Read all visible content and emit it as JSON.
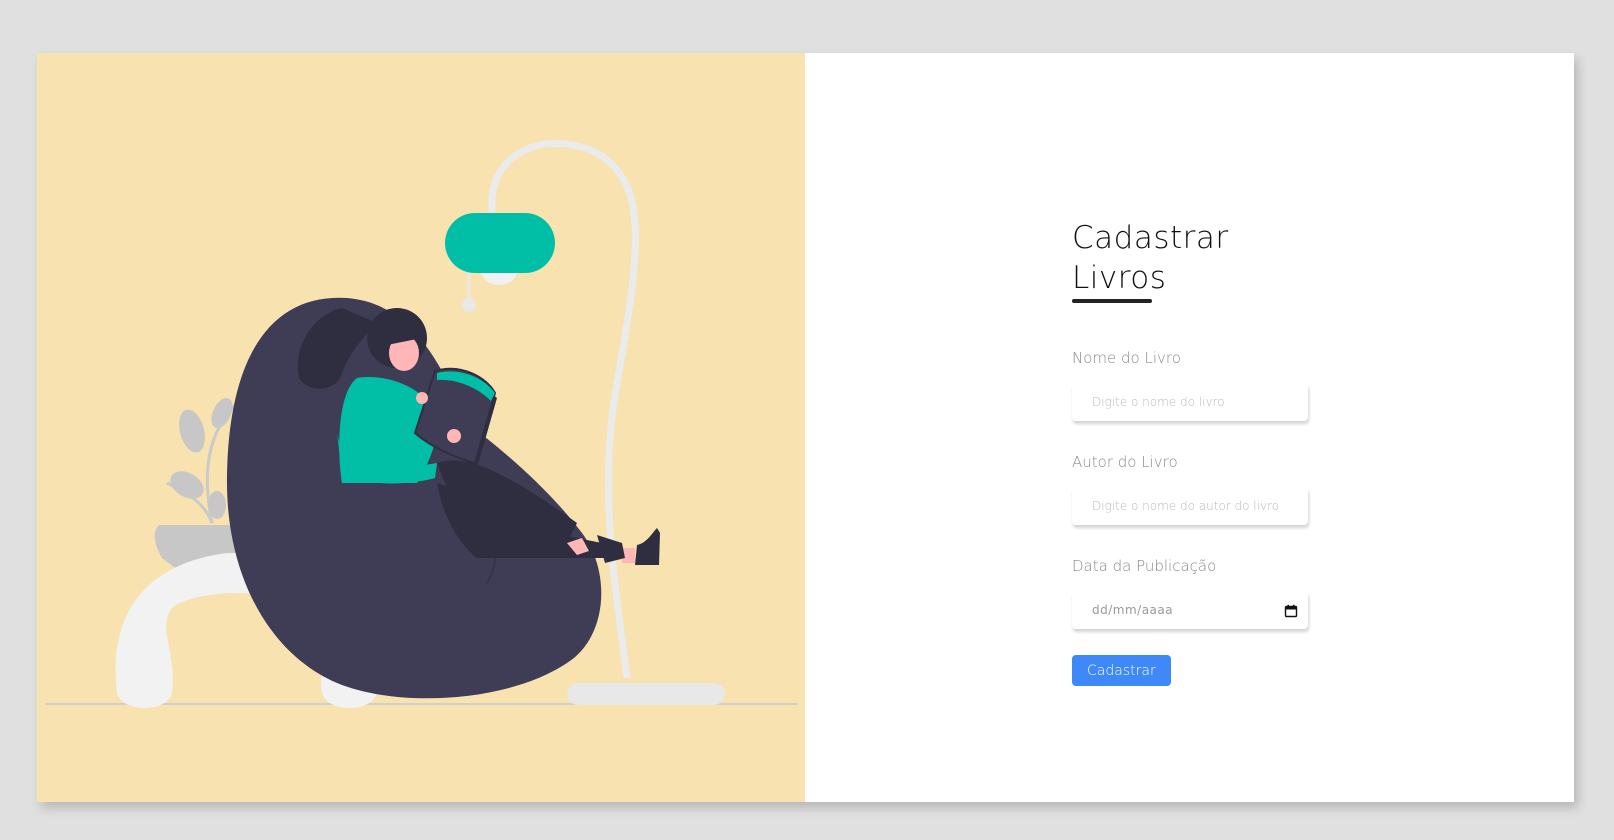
{
  "form": {
    "title": "Cadastrar Livros",
    "fields": [
      {
        "label": "Nome do Livro",
        "placeholder": "Digite o nome do livro",
        "value": ""
      },
      {
        "label": "Autor do Livro",
        "placeholder": "Digite o nome do autor do livro",
        "value": ""
      },
      {
        "label": "Data da Publicação",
        "placeholder": "dd/mm/aaaa",
        "value": ""
      }
    ],
    "submit_label": "Cadastrar"
  },
  "icons": {
    "date_picker": "calendar-icon"
  },
  "colors": {
    "illustration_background": "#f8e2b0",
    "accent_teal": "#00bfa6",
    "button_blue": "#3e89f7",
    "chair": "#3f3d56"
  }
}
